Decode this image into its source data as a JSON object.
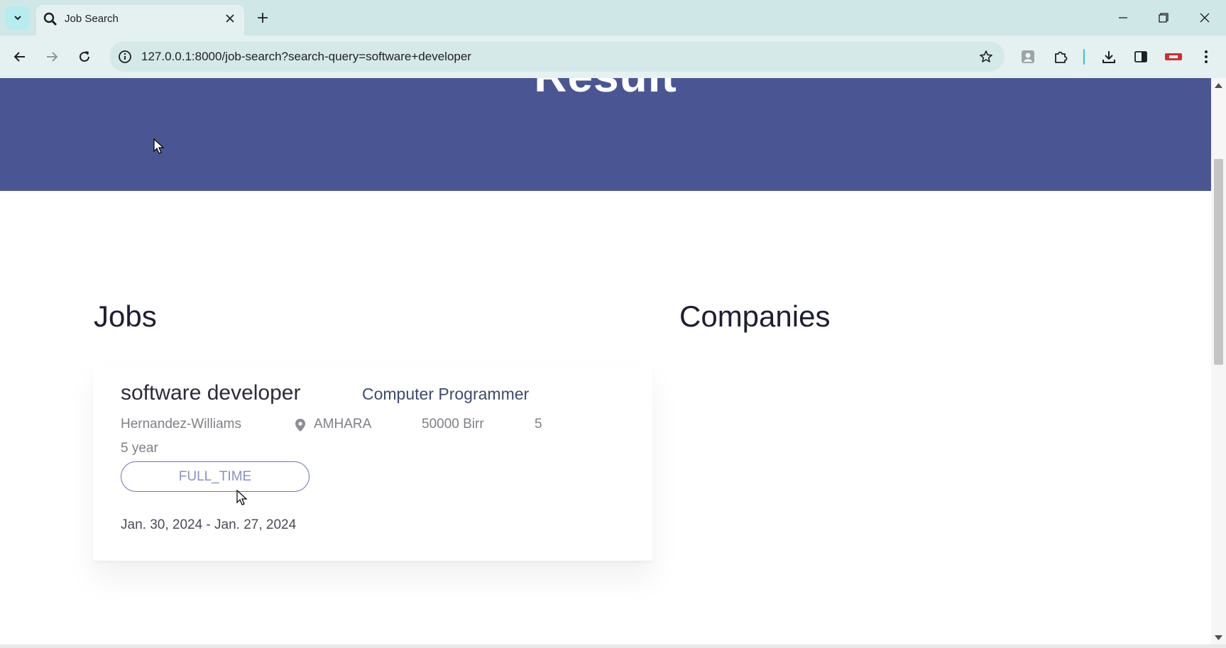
{
  "browser": {
    "tab_title": "Job Search",
    "url": "127.0.0.1:8000/job-search?search-query=software+developer"
  },
  "page": {
    "hero_title": "Result",
    "jobs_heading": "Jobs",
    "companies_heading": "Companies"
  },
  "jobs": [
    {
      "title": "software developer",
      "category": "Computer Programmer",
      "company": "Hernandez-Williams",
      "location": "AMHARA",
      "salary": "50000 Birr",
      "vacancies": "5",
      "experience": "5 year",
      "job_type": "FULL_TIME",
      "dates": "Jan. 30, 2024 - Jan. 27, 2024"
    }
  ],
  "colors": {
    "hero_bg": "#4a5694",
    "accent": "#6c77b5",
    "chrome_bg": "#cfe7e6"
  }
}
